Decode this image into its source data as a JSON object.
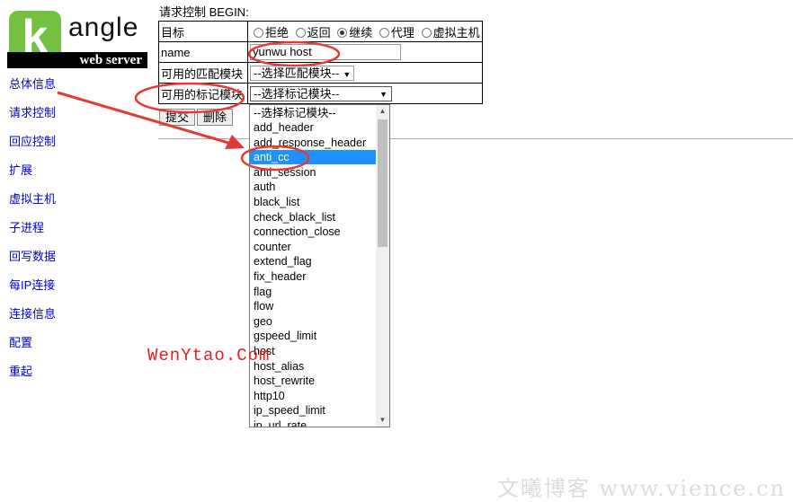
{
  "logo": {
    "letter": "k",
    "word": "angle",
    "tagline": "web server"
  },
  "sidebar": {
    "items": [
      "总体信息",
      "请求控制",
      "回应控制",
      "扩展",
      "虚拟主机",
      "子进程",
      "回写数据",
      "每IP连接",
      "连接信息",
      "配置",
      "重起"
    ]
  },
  "form": {
    "title": "请求控制 BEGIN:",
    "rows": {
      "target": {
        "label": "目标",
        "options": [
          "拒绝",
          "返回",
          "继续",
          "代理",
          "虚拟主机"
        ],
        "selected": "继续"
      },
      "name": {
        "label": "name",
        "value": "yunwu host"
      },
      "match": {
        "label": "可用的匹配模块",
        "value": "--选择匹配模块--"
      },
      "mark": {
        "label": "可用的标记模块",
        "value": "--选择标记模块--"
      }
    },
    "buttons": {
      "submit": "提交",
      "delete": "删除"
    }
  },
  "dropdown": {
    "selected": "anti_cc",
    "options": [
      "--选择标记模块--",
      "add_header",
      "add_response_header",
      "anti_cc",
      "anti_session",
      "auth",
      "black_list",
      "check_black_list",
      "connection_close",
      "counter",
      "extend_flag",
      "fix_header",
      "flag",
      "flow",
      "geo",
      "gspeed_limit",
      "host",
      "host_alias",
      "host_rewrite",
      "http10",
      "ip_speed_limit",
      "ip_url_rate"
    ]
  },
  "annotations": {
    "highlight_color": "#e53935"
  },
  "watermarks": {
    "red": "WenYtao.Com",
    "gray": "文曦博客 www.vience.cn"
  }
}
